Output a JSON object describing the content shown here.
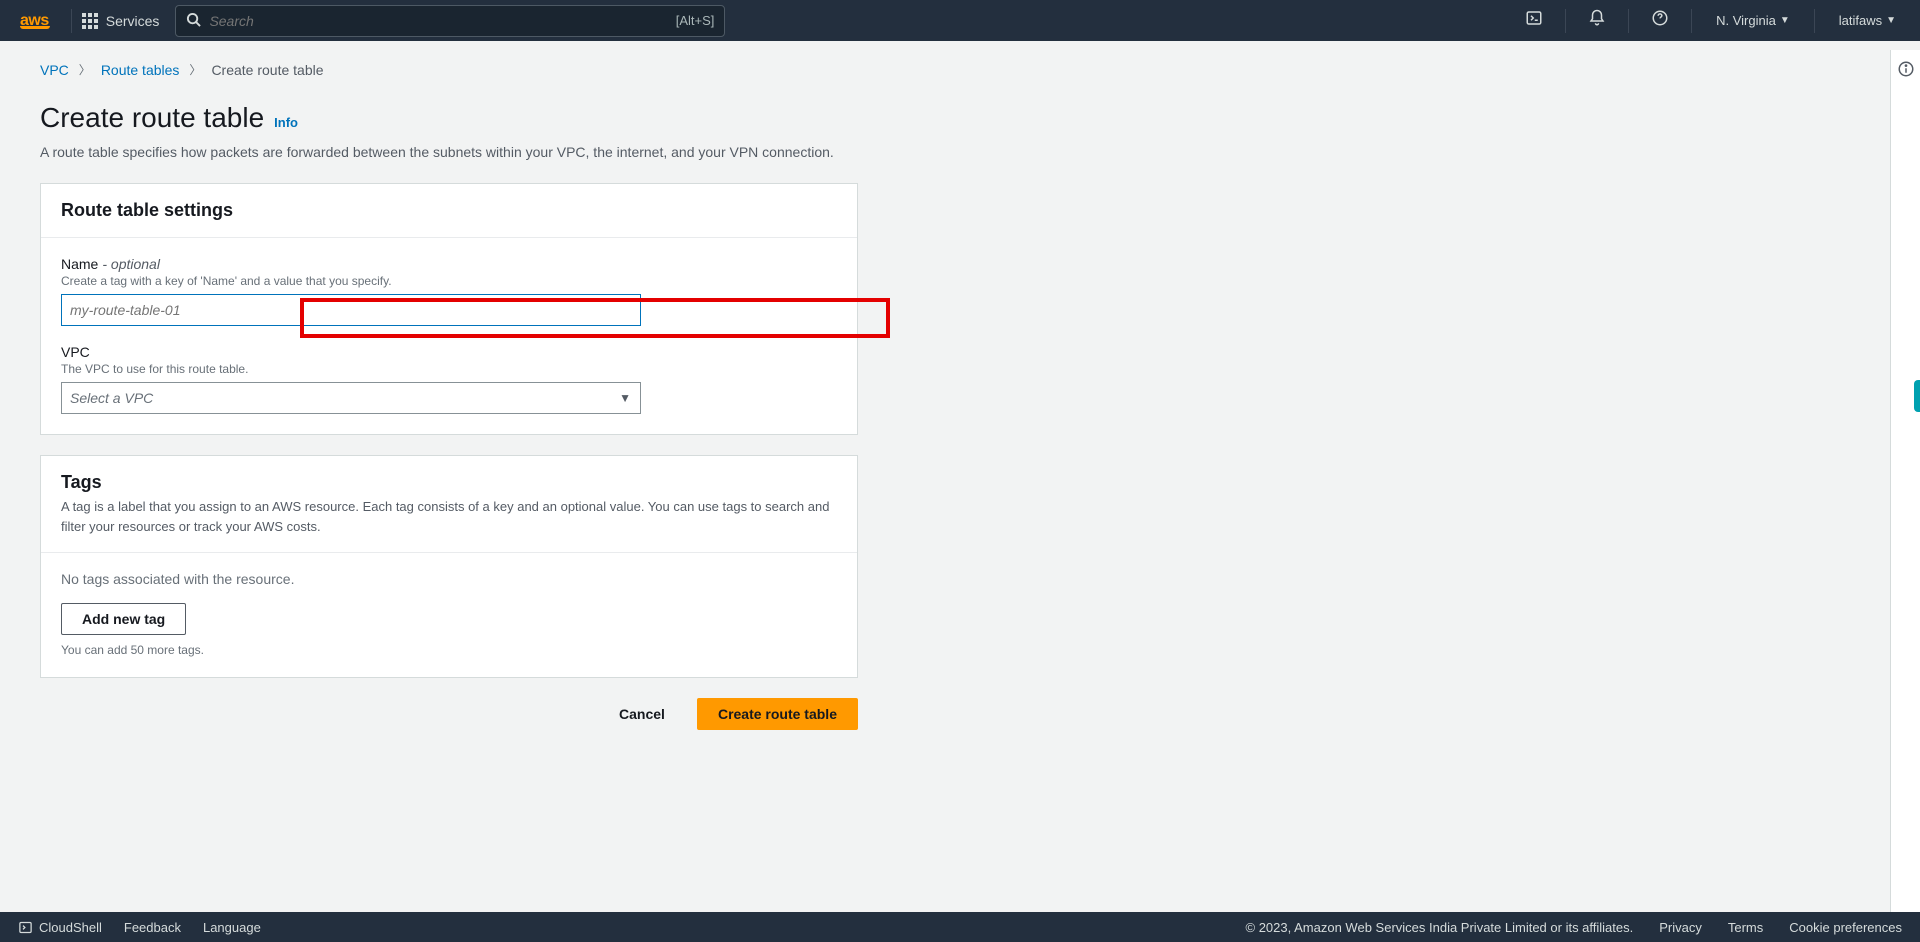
{
  "header": {
    "logo_text": "aws",
    "services_label": "Services",
    "search_placeholder": "Search",
    "search_shortcut": "[Alt+S]",
    "region": "N. Virginia",
    "account": "latifaws"
  },
  "breadcrumb": {
    "items": [
      "VPC",
      "Route tables",
      "Create route table"
    ]
  },
  "page": {
    "title": "Create route table",
    "info_label": "Info",
    "description": "A route table specifies how packets are forwarded between the subnets within your VPC, the internet, and your VPN connection."
  },
  "settings_panel": {
    "title": "Route table settings",
    "name": {
      "label": "Name",
      "optional": "- optional",
      "hint": "Create a tag with a key of 'Name' and a value that you specify.",
      "placeholder": "my-route-table-01",
      "value": ""
    },
    "vpc": {
      "label": "VPC",
      "hint": "The VPC to use for this route table.",
      "placeholder": "Select a VPC",
      "value": ""
    }
  },
  "tags_panel": {
    "title": "Tags",
    "description": "A tag is a label that you assign to an AWS resource. Each tag consists of a key and an optional value. You can use tags to search and filter your resources or track your AWS costs.",
    "no_tags_text": "No tags associated with the resource.",
    "add_button": "Add new tag",
    "remaining_hint": "You can add 50 more tags."
  },
  "actions": {
    "cancel": "Cancel",
    "create": "Create route table"
  },
  "footer": {
    "cloudshell": "CloudShell",
    "feedback": "Feedback",
    "language": "Language",
    "copyright": "© 2023, Amazon Web Services India Private Limited or its affiliates.",
    "privacy": "Privacy",
    "terms": "Terms",
    "cookies": "Cookie preferences"
  }
}
